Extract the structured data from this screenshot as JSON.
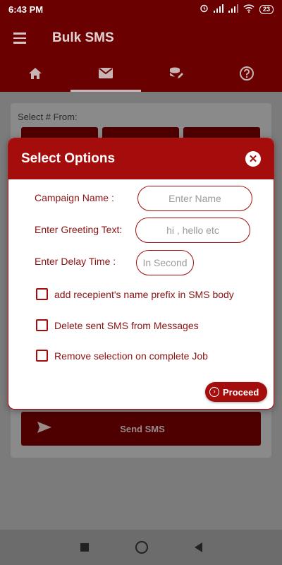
{
  "status": {
    "time": "6:43 PM",
    "battery": "23"
  },
  "app": {
    "title": "Bulk SMS"
  },
  "tabs": [
    {
      "icon": "home-icon"
    },
    {
      "icon": "mail-icon"
    },
    {
      "icon": "database-edit-icon"
    },
    {
      "icon": "help-icon"
    }
  ],
  "background": {
    "select_label": "Select # From:",
    "send_label": "Send SMS"
  },
  "dialog": {
    "title": "Select Options",
    "fields": {
      "campaign": {
        "label": "Campaign Name :",
        "placeholder": "Enter Name"
      },
      "greeting": {
        "label": "Enter Greeting Text:",
        "placeholder": "hi , hello etc"
      },
      "delay": {
        "label": "Enter Delay Time :",
        "placeholder": "In Second"
      }
    },
    "checks": [
      {
        "label": "add recepient's name prefix in SMS body"
      },
      {
        "label": "Delete sent SMS from Messages"
      },
      {
        "label": "Remove selection on complete Job"
      }
    ],
    "proceed_label": "Proceed"
  },
  "colors": {
    "primary_dark": "#6b0000",
    "accent": "#a50d0d",
    "text_red": "#8a1212"
  }
}
